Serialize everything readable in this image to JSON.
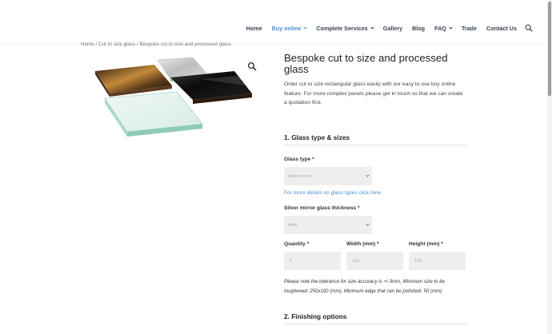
{
  "nav": {
    "items": [
      {
        "label": "Home",
        "dropdown": false,
        "active": false
      },
      {
        "label": "Buy online",
        "dropdown": true,
        "active": true
      },
      {
        "label": "Complete Services",
        "dropdown": true,
        "active": false
      },
      {
        "label": "Gallery",
        "dropdown": false,
        "active": false
      },
      {
        "label": "Blog",
        "dropdown": false,
        "active": false
      },
      {
        "label": "FAQ",
        "dropdown": true,
        "active": false
      },
      {
        "label": "Trade",
        "dropdown": false,
        "active": false
      },
      {
        "label": "Contact Us",
        "dropdown": false,
        "active": false
      }
    ],
    "search_icon": "search-icon"
  },
  "breadcrumb": "Home / Cut to size glass / Bespoke cut to size and processed glass",
  "product": {
    "title": "Bespoke cut to size and processed glass",
    "intro": "Order cut to size rectangular glass easily with our easy to use buy online feature. For more complex panels please get in touch so that we can create a quotation first.",
    "zoom_icon": "magnifier-icon"
  },
  "form": {
    "section1": "1. Glass type & sizes",
    "glass_type_label": "Glass type *",
    "glass_type_value": "Silver mirror",
    "details_link": "For more details on glass types click here",
    "thickness_label": "Silver mirror glass thickness *",
    "thickness_value": "4mm",
    "quantity_label": "Quantity *",
    "quantity_value": "1",
    "width_label": "Width (mm) *",
    "width_value": "100",
    "height_label": "Height (mm) *",
    "height_value": "100",
    "note": "Please note the tolerance for size accuracy is +/-3mm, Minimum size to be toughened: 250x100 (mm), Minimum edge that can be polished: 50 (mm)",
    "section2": "2. Finishing options"
  },
  "colors": {
    "accent": "#4a90d6",
    "nav_text": "#3a4452",
    "field_bg": "#eeeeee"
  }
}
